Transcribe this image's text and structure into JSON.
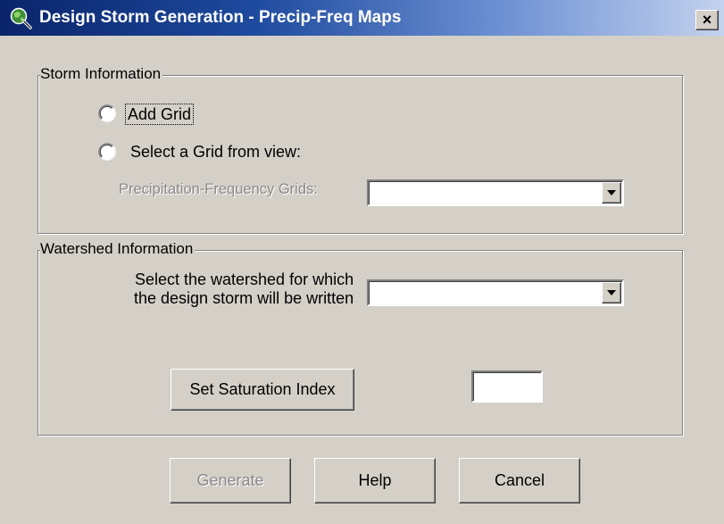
{
  "window": {
    "title": "Design Storm Generation - Precip-Freq Maps",
    "icon": "globe-magnifier-icon",
    "close_label": "×"
  },
  "storm": {
    "legend": "Storm Information",
    "add_grid_label": "Add Grid",
    "add_grid_selected": false,
    "select_grid_label": "Select a Grid from view:",
    "select_grid_selected": false,
    "grids_label": "Precipitation-Frequency Grids:",
    "grids_value": "",
    "grids_enabled": false
  },
  "watershed": {
    "legend": "Watershed Information",
    "select_label_line1": "Select the watershed for which",
    "select_label_line2": "the design storm will be written",
    "select_value": "",
    "saturation_button": "Set Saturation Index",
    "saturation_value": ""
  },
  "buttons": {
    "generate": "Generate",
    "generate_enabled": false,
    "help": "Help",
    "cancel": "Cancel"
  },
  "colors": {
    "titlebar_start": "#0a246a",
    "titlebar_end": "#c3d2ee",
    "face": "#d4d0c8",
    "disabled_text": "#8a8a8a"
  }
}
